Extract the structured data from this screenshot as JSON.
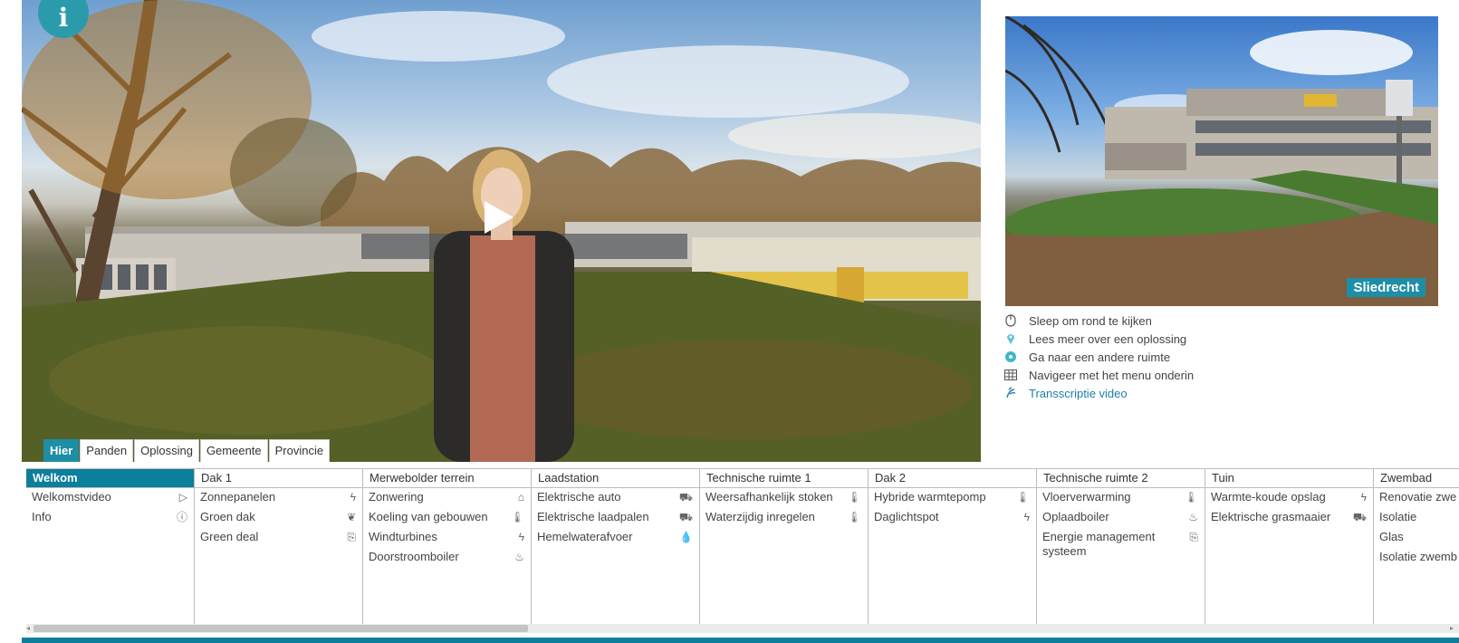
{
  "main_view": {
    "info_badge": "i",
    "view_tabs": [
      "Hier",
      "Panden",
      "Oplossing",
      "Gemeente",
      "Provincie"
    ]
  },
  "preview": {
    "location_label": "Sliedrecht"
  },
  "legend": [
    {
      "icon": "mouse-icon",
      "text": "Sleep om rond te kijken"
    },
    {
      "icon": "pin-icon",
      "text": "Lees meer over een oplossing"
    },
    {
      "icon": "navigate-icon",
      "text": "Ga naar een andere ruimte"
    },
    {
      "icon": "grid-icon",
      "text": "Navigeer met het menu onderin"
    },
    {
      "icon": "accessibility-icon",
      "text": "Transscriptie video"
    }
  ],
  "menu": [
    {
      "title": "Welkom",
      "active": true,
      "items": [
        {
          "label": "Welkomstvideo",
          "icon": "▷"
        },
        {
          "label": "Info",
          "icon": "ⓘ"
        }
      ]
    },
    {
      "title": "Dak 1",
      "items": [
        {
          "label": "Zonnepanelen",
          "icon": "ϟ"
        },
        {
          "label": "Groen dak",
          "icon": "❦"
        },
        {
          "label": "Green deal",
          "icon": "⎘"
        }
      ]
    },
    {
      "title": "Merwebolder terrein",
      "items": [
        {
          "label": "Zonwering",
          "icon": "⌂"
        },
        {
          "label": "Koeling van gebouwen",
          "icon": "🌡"
        },
        {
          "label": "Windturbines",
          "icon": "ϟ"
        },
        {
          "label": "Doorstroomboiler",
          "icon": "♨"
        }
      ]
    },
    {
      "title": "Laadstation",
      "items": [
        {
          "label": "Elektrische auto",
          "icon": "⛟"
        },
        {
          "label": "Elektrische laadpalen",
          "icon": "⛟"
        },
        {
          "label": "Hemelwaterafvoer",
          "icon": "💧"
        }
      ]
    },
    {
      "title": "Technische ruimte 1",
      "items": [
        {
          "label": "Weersafhankelijk stoken",
          "icon": "🌡"
        },
        {
          "label": "Waterzijdig inregelen",
          "icon": "🌡"
        }
      ]
    },
    {
      "title": "Dak 2",
      "items": [
        {
          "label": "Hybride warmtepomp",
          "icon": "🌡"
        },
        {
          "label": "Daglichtspot",
          "icon": "ϟ"
        }
      ]
    },
    {
      "title": "Technische ruimte 2",
      "items": [
        {
          "label": "Vloerverwarming",
          "icon": "🌡"
        },
        {
          "label": "Oplaadboiler",
          "icon": "♨"
        },
        {
          "label": "Energie management systeem",
          "icon": "⎘"
        }
      ]
    },
    {
      "title": "Tuin",
      "items": [
        {
          "label": "Warmte-koude opslag",
          "icon": "ϟ"
        },
        {
          "label": "Elektrische grasmaaier",
          "icon": "⛟"
        }
      ]
    },
    {
      "title": "Zwembad",
      "items": [
        {
          "label": "Renovatie zwe",
          "icon": ""
        },
        {
          "label": "Isolatie",
          "icon": ""
        },
        {
          "label": "Glas",
          "icon": ""
        },
        {
          "label": "Isolatie zwemb",
          "icon": ""
        }
      ]
    }
  ]
}
